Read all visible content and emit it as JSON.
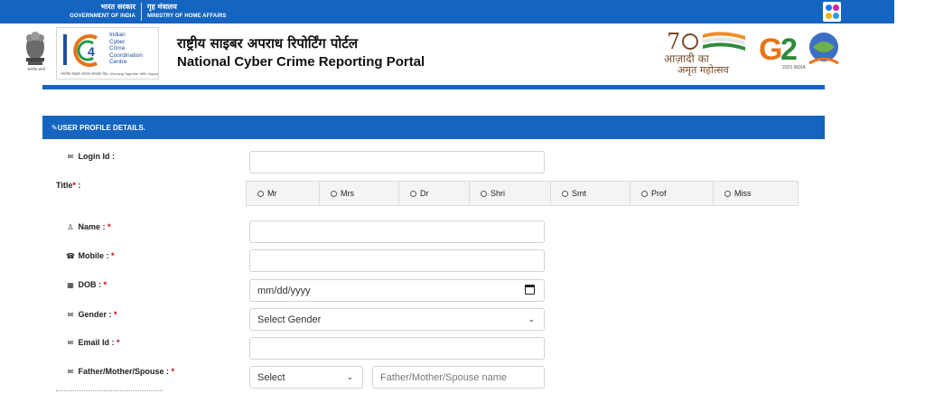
{
  "gov_strip": {
    "col1_hi": "भारत सरकार",
    "col1_en": "GOVERNMENT OF INDIA",
    "col2_hi": "गृह मंत्रालय",
    "col2_en": "MINISTRY OF HOME AFFAIRS"
  },
  "header": {
    "emblem_caption": "सत्यमेव जयते",
    "i4c_lines": [
      "Indian",
      "Cyber",
      "Crime",
      "Coordination",
      "Centre"
    ],
    "i4c_tagline": "भारतीय साइबर अपराध समन्वय केंद्र • Working Together With Vigour",
    "title_hi": "राष्ट्रीय साइबर अपराध रिपोर्टिंग पोर्टल",
    "title_en": "National Cyber Crime Reporting Portal",
    "azadi_line1": "आज़ादी का",
    "azadi_line2": "अमृत महोत्सव",
    "g20_caption": "2023 INDIA",
    "colors": {
      "primary": "#1565c0",
      "required": "#d50000"
    }
  },
  "form": {
    "section_title": "USER PROFILE DETAILS.",
    "section_icon": "edit-icon",
    "login_label": "Login Id :",
    "title_label": "Title",
    "title_options": [
      "Mr",
      "Mrs",
      "Dr",
      "Shri",
      "Smt",
      "Prof",
      "Miss"
    ],
    "name_label": "Name : ",
    "mobile_label": "Mobile : ",
    "dob_label": "DOB : ",
    "dob_placeholder": "mm/dd/yyyy",
    "gender_label": "Gender : ",
    "gender_selected": "Select Gender",
    "email_label": "Email Id : ",
    "relation_label": "Father/Mother/Spouse : ",
    "relation_selected": "Select",
    "relation_name_placeholder": "Father/Mother/Spouse name",
    "required_mark": "*",
    "title_suffix": " :"
  }
}
